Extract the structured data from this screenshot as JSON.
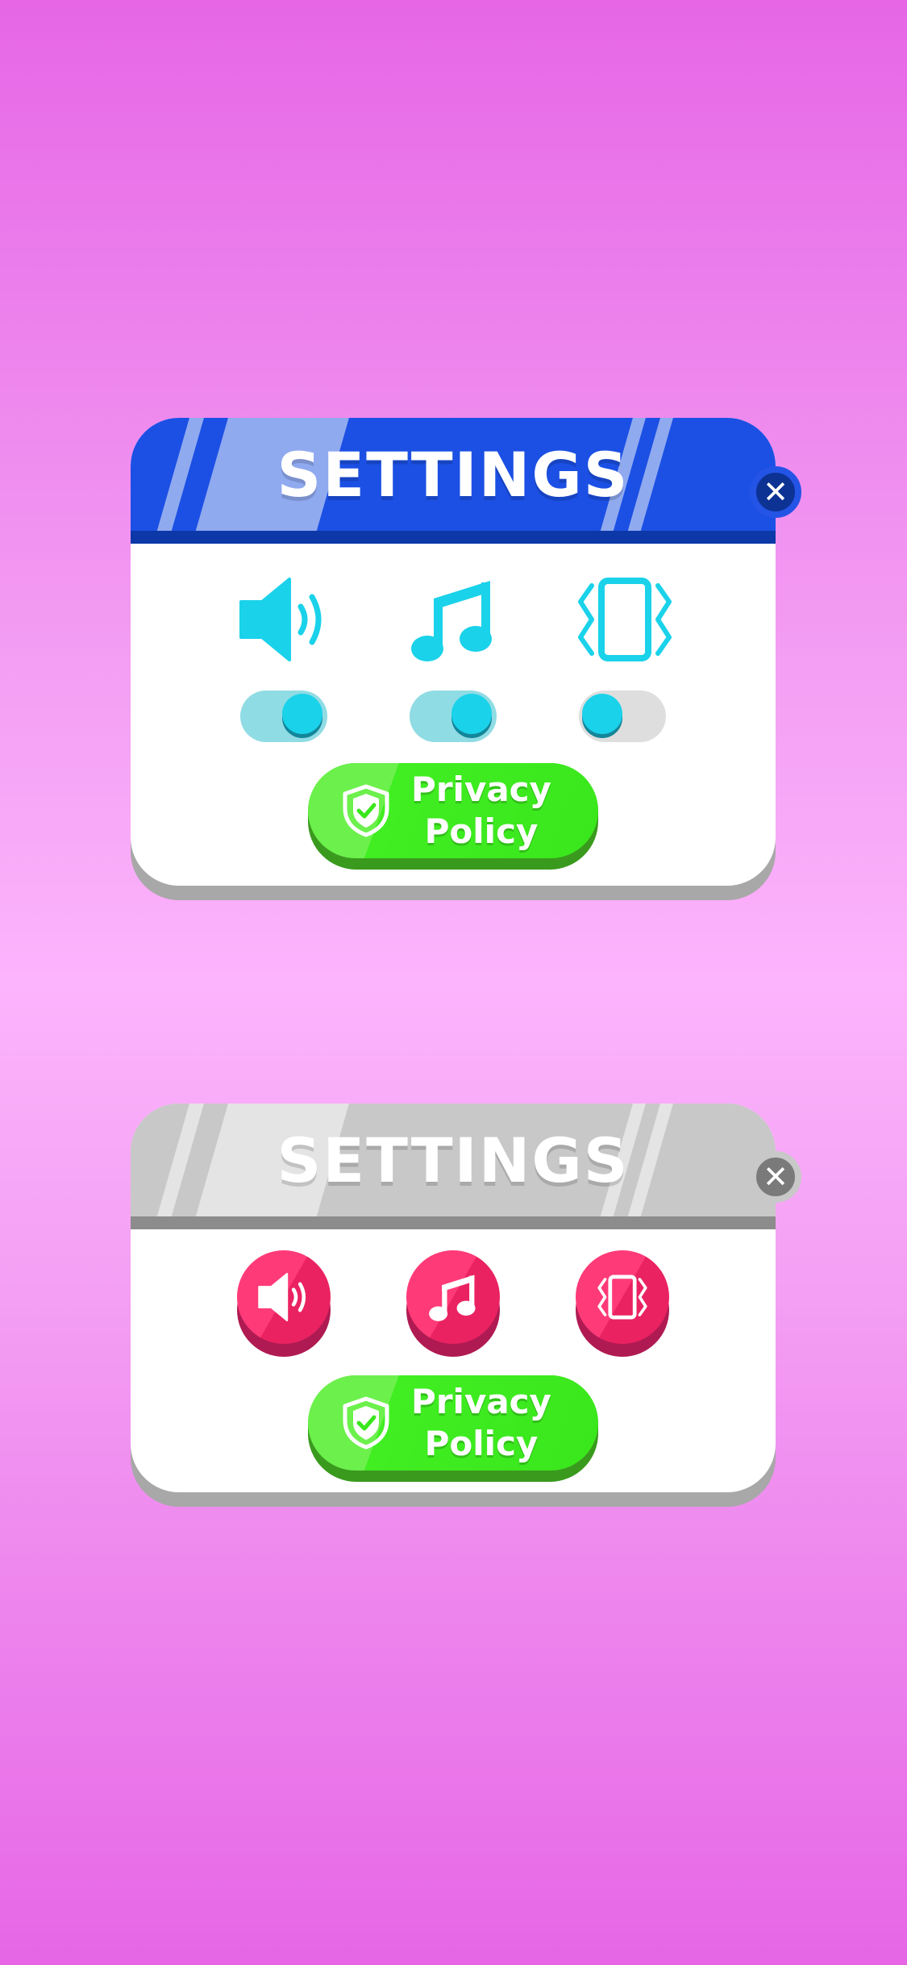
{
  "colors": {
    "background": "#f4a0f4",
    "header_active": "#1c50e4",
    "header_disabled": "#c8c8c8",
    "toggle_knob": "#1ad2ea",
    "privacy_button": "#3ae61c",
    "round_button": "#ea2262"
  },
  "panels": [
    {
      "title": "SETTINGS",
      "close_icon": "close-icon",
      "options": [
        {
          "icon": "speaker-icon",
          "toggle_on": true
        },
        {
          "icon": "music-note-icon",
          "toggle_on": true
        },
        {
          "icon": "vibrate-icon",
          "toggle_on": false
        }
      ],
      "privacy": {
        "icon": "shield-check-icon",
        "line1": "Privacy",
        "line2": "Policy"
      }
    },
    {
      "title": "SETTINGS",
      "close_icon": "close-icon",
      "options": [
        {
          "icon": "speaker-icon"
        },
        {
          "icon": "music-note-icon"
        },
        {
          "icon": "vibrate-icon"
        }
      ],
      "privacy": {
        "icon": "shield-check-icon",
        "line1": "Privacy",
        "line2": "Policy"
      }
    }
  ]
}
